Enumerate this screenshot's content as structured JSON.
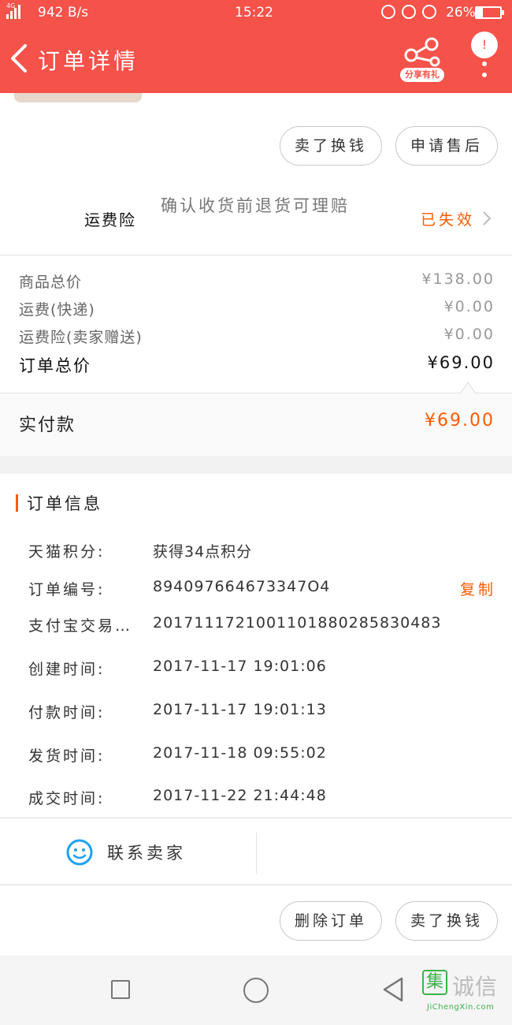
{
  "status_bar": {
    "network": "4G",
    "speed": "942 B/s",
    "time": "15:22",
    "battery": "26%",
    "battery_level": 0.26
  },
  "header": {
    "title": "订单详情",
    "share_label": "分享有礼",
    "more_badge": "!"
  },
  "product_actions": {
    "return_exchange": "卖了换钱",
    "after_sale": "申请售后"
  },
  "shipping_insurance": {
    "label": "运费险",
    "description": "确认收货前退货可理赔",
    "status": "已失效"
  },
  "price_summary": {
    "rows": [
      {
        "label": "商品总价",
        "value": "¥138.00"
      },
      {
        "label": "运费(快递)",
        "value": "¥0.00"
      },
      {
        "label": "运费险(卖家赠送)",
        "value": "¥0.00"
      }
    ],
    "total_label": "订单总价",
    "total_value": "¥69.00",
    "paid_label": "实付款",
    "paid_value": "¥69.00"
  },
  "order_info": {
    "section_title": "订单信息",
    "copy_label": "复制",
    "items": [
      {
        "label": "天猫积分:",
        "value": "获得34点积分"
      },
      {
        "label": "订单编号:",
        "value": "894097664673347O4"
      },
      {
        "label": "支付宝交易…",
        "value": "2017111721001101880285830483"
      },
      {
        "label": "创建时间:",
        "value": "2017-11-17 19:01:06"
      },
      {
        "label": "付款时间:",
        "value": "2017-11-17 19:01:13"
      },
      {
        "label": "发货时间:",
        "value": "2017-11-18 09:55:02"
      },
      {
        "label": "成交时间:",
        "value": "2017-11-22 21:44:48"
      }
    ]
  },
  "contact": {
    "label": "联系卖家"
  },
  "bottom_actions": {
    "delete_order": "删除订单",
    "sell": "卖了换钱"
  },
  "watermark": {
    "cn": "诚信",
    "box_char": "集",
    "en": "JiChengXin.com"
  },
  "colors": {
    "header_red": "#f5524a",
    "accent_orange": "#ff5a00"
  }
}
